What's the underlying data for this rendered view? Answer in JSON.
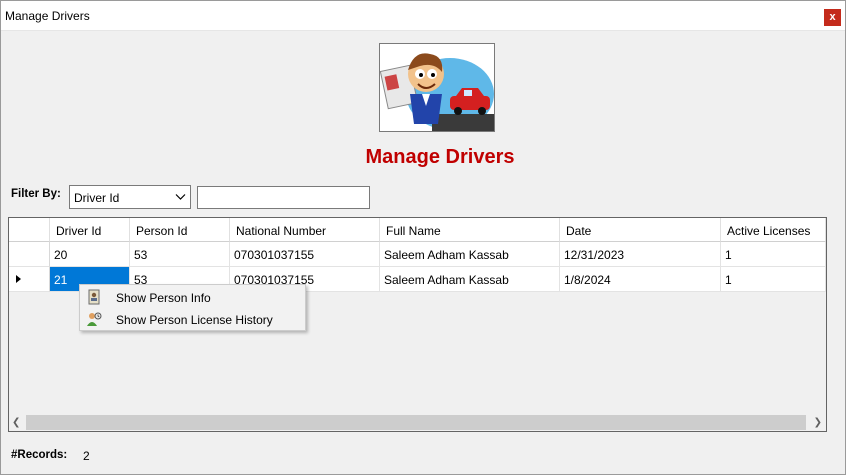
{
  "window": {
    "title": "Manage Drivers",
    "close_glyph": "x"
  },
  "heading": "Manage Drivers",
  "filter": {
    "label": "Filter By:",
    "selected": "Driver Id",
    "search_value": ""
  },
  "table": {
    "columns": [
      "Driver Id",
      "Person Id",
      "National Number",
      "Full Name",
      "Date",
      "Active Licenses"
    ],
    "rows": [
      [
        "20",
        "53",
        "070301037155",
        "Saleem Adham Kassab",
        "12/31/2023",
        "1"
      ],
      [
        "21",
        "53",
        "070301037155",
        "Saleem Adham Kassab",
        "1/8/2024",
        "1"
      ]
    ],
    "selected_row": 1
  },
  "context_menu": {
    "items": [
      {
        "label": "Show Person Info",
        "icon": "id-card-icon"
      },
      {
        "label": "Show Person License History",
        "icon": "person-history-icon"
      }
    ]
  },
  "footer": {
    "records_label": "#Records:",
    "records_value": "2"
  },
  "colors": {
    "heading": "#c00000",
    "selection": "#0078d7",
    "close": "#c42b1c"
  }
}
